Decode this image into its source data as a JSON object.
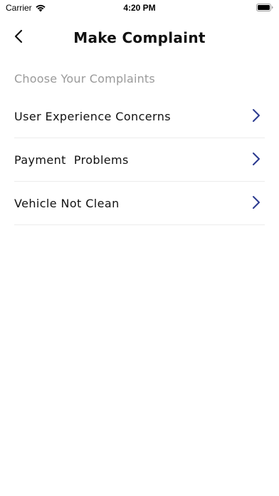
{
  "status_bar": {
    "carrier": "Carrier",
    "time": "4:20 PM",
    "wifi_icon": "wifi-icon",
    "battery_icon": "battery-icon"
  },
  "header": {
    "title": "Make Complaint",
    "back_icon": "chevron-left-icon"
  },
  "section": {
    "label": "Choose Your Complaints"
  },
  "complaints": [
    {
      "label": "User Experience Concerns",
      "icon": "chevron-right-icon"
    },
    {
      "label": "Payment  Problems",
      "icon": "chevron-right-icon"
    },
    {
      "label": "Vehicle Not Clean",
      "icon": "chevron-right-icon"
    }
  ],
  "colors": {
    "chevron_accent": "#2b3a8f",
    "section_label": "#9a9a9a",
    "divider": "#ececec"
  }
}
